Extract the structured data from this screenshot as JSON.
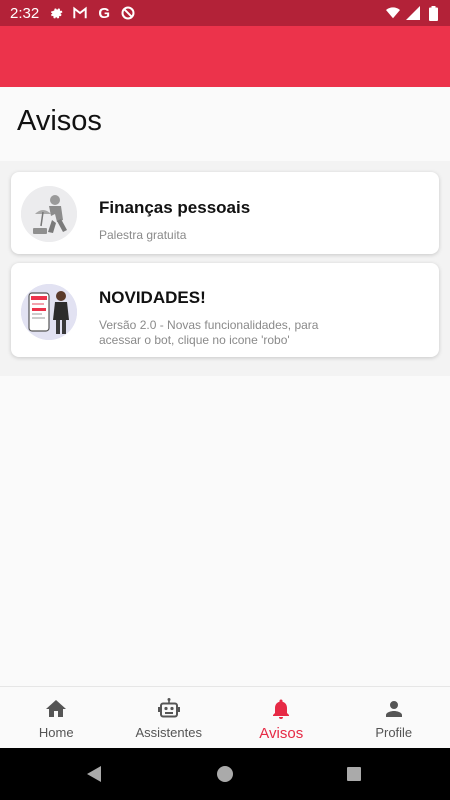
{
  "status_bar": {
    "time": "2:32",
    "icons": [
      "gear-icon",
      "gmail-icon",
      "google-icon",
      "circle-slash-icon",
      "wifi-icon",
      "signal-icon",
      "battery-icon"
    ]
  },
  "page": {
    "title": "Avisos"
  },
  "notices": [
    {
      "title": "Finanças pessoais",
      "subtitle": "Palestra gratuita",
      "image": "man-with-umbrella-illustration"
    },
    {
      "title": "NOVIDADES!",
      "subtitle": "Versão 2.0 - Novas funcionalidades, para acessar o bot, clique no icone 'robo'",
      "image": "woman-with-phone-illustration"
    }
  ],
  "bottom_nav": {
    "items": [
      {
        "label": "Home",
        "icon": "home-icon"
      },
      {
        "label": "Assistentes",
        "icon": "robot-icon"
      },
      {
        "label": "Avisos",
        "icon": "bell-icon"
      },
      {
        "label": "Profile",
        "icon": "person-icon"
      }
    ],
    "active": "Avisos"
  },
  "colors": {
    "status_bar": "#b32238",
    "app_bar": "#ec334b",
    "active_tab": "#e62a45"
  }
}
